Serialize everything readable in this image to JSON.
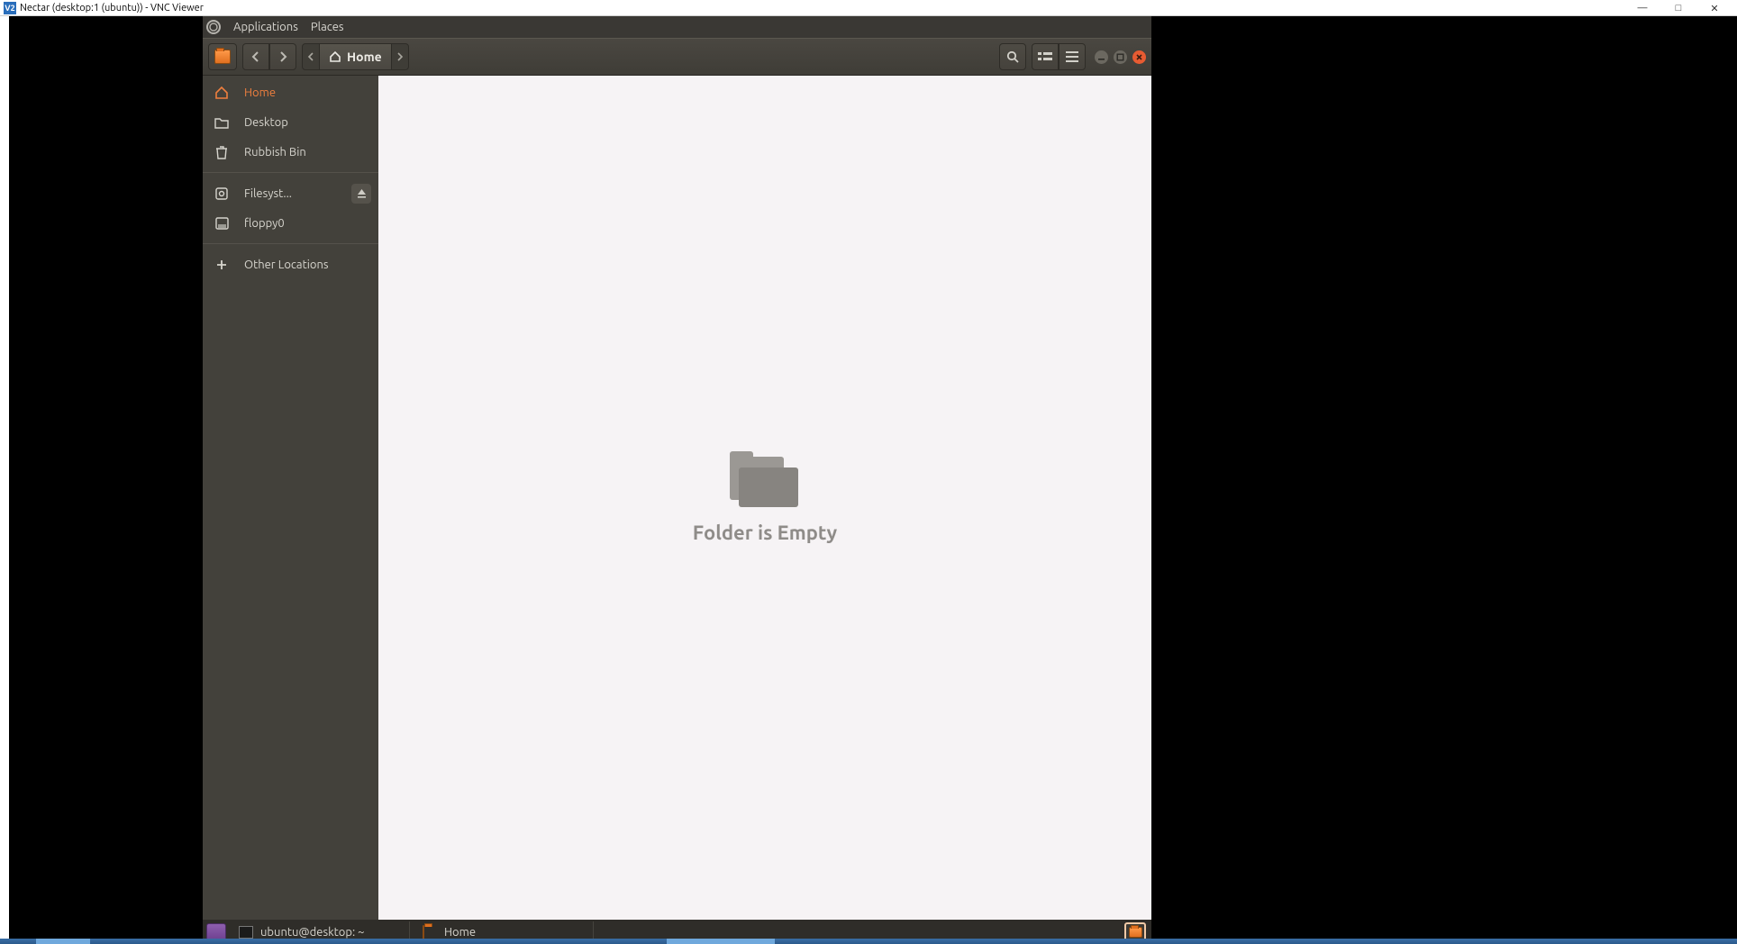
{
  "host_window": {
    "title": "Nectar (desktop:1 (ubuntu)) - VNC Viewer",
    "icon_text": "V2",
    "controls": {
      "minimize": "—",
      "maximize": "□",
      "close": "✕"
    }
  },
  "gnome_menu": {
    "applications": "Applications",
    "places": "Places"
  },
  "toolbar": {
    "path_label": "Home"
  },
  "sidebar": {
    "items": [
      {
        "label": "Home",
        "icon": "home",
        "active": true,
        "eject": false
      },
      {
        "label": "Desktop",
        "icon": "folder",
        "active": false,
        "eject": false
      },
      {
        "label": "Rubbish Bin",
        "icon": "trash",
        "active": false,
        "eject": false
      },
      {
        "label": "Filesyst...",
        "icon": "disk",
        "active": false,
        "eject": true
      },
      {
        "label": "floppy0",
        "icon": "floppy",
        "active": false,
        "eject": false
      },
      {
        "label": "Other Locations",
        "icon": "plus",
        "active": false,
        "eject": false
      }
    ]
  },
  "content": {
    "empty_message": "Folder is Empty"
  },
  "bottom_panel": {
    "tasks": [
      {
        "label": "ubuntu@desktop: ~",
        "icon": "terminal"
      },
      {
        "label": "Home",
        "icon": "files"
      }
    ]
  }
}
